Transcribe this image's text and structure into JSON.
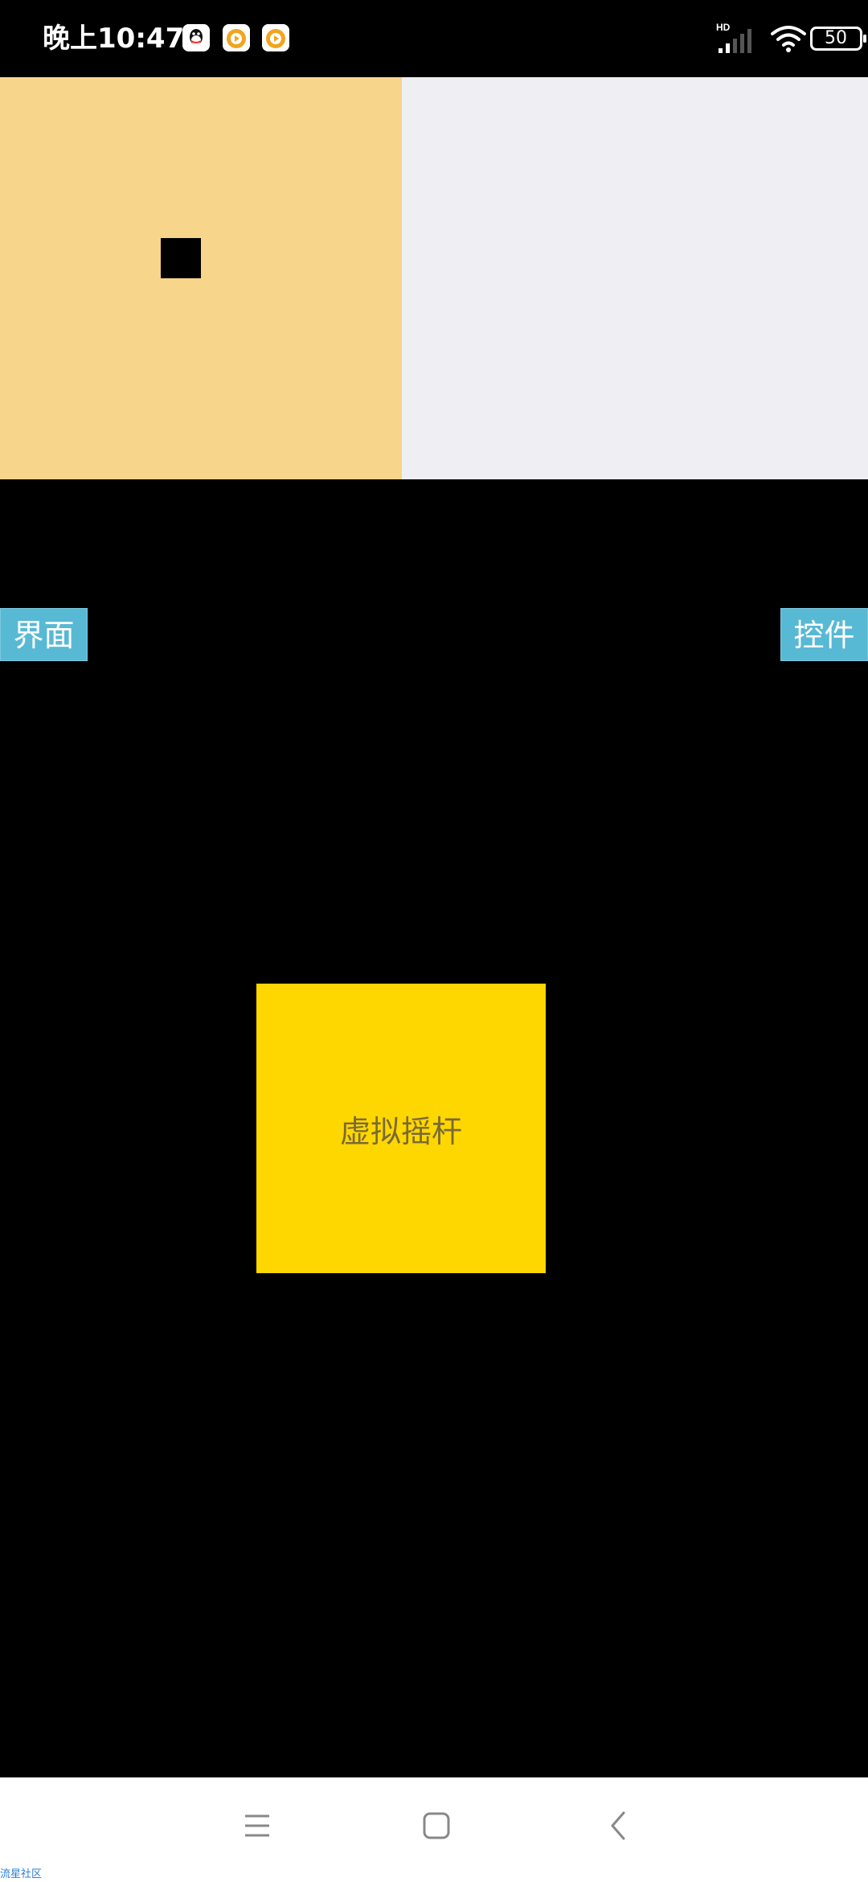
{
  "status_bar": {
    "time": "晚上10:47",
    "network_label": "HD",
    "battery_level": "50",
    "icons": [
      "qq-icon",
      "app-icon",
      "app-icon",
      "signal-icon",
      "wifi-icon",
      "battery-icon"
    ]
  },
  "panels": {
    "left_color": "#F7D58A",
    "right_color": "#EFEEF3"
  },
  "buttons": {
    "left_label": "界面",
    "right_label": "控件",
    "color": "#58B9D4"
  },
  "joystick": {
    "label": "虚拟摇杆",
    "color": "#FFD700"
  },
  "nav_bar": {
    "icons": [
      "menu-icon",
      "home-icon",
      "back-icon"
    ]
  },
  "watermark": {
    "text": "流星社区"
  }
}
